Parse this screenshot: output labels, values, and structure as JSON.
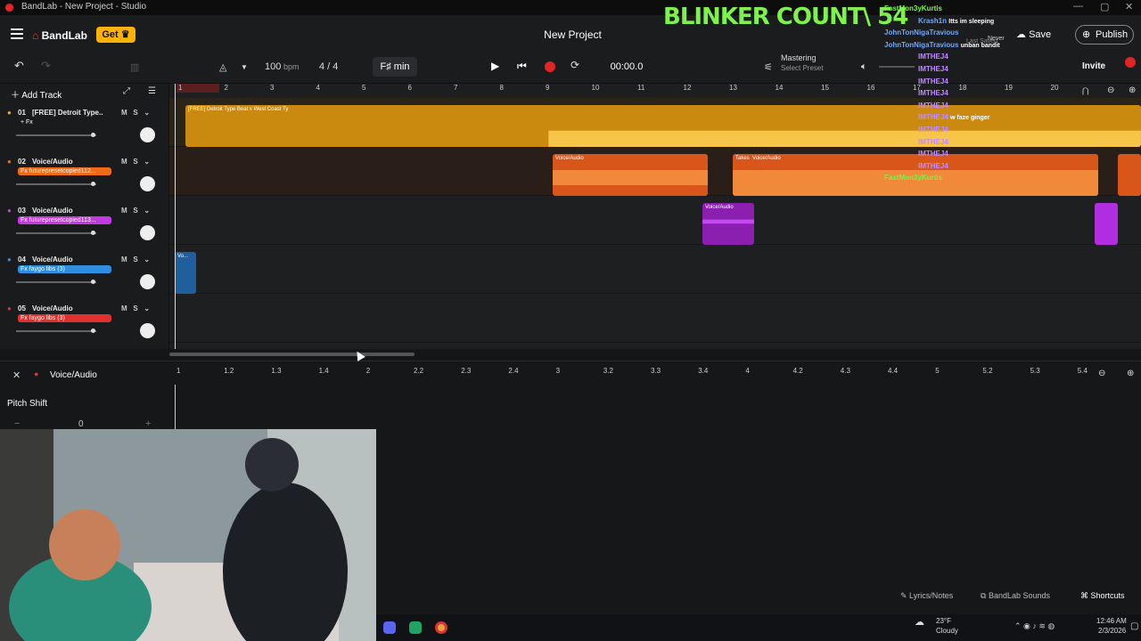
{
  "window": {
    "title": "BandLab - New Project - Studio"
  },
  "header": {
    "logo": "BandLab",
    "get_label": "Get",
    "project_title": "New Project",
    "save_label": "Save",
    "publish_label": "Publish",
    "last_saved": "Last Saved"
  },
  "toolbar": {
    "bpm": "100",
    "bpm_unit": "bpm",
    "time_sig": "4 / 4",
    "key": "F♯ min",
    "time": "00:00.0",
    "mastering": "Mastering",
    "select_preset": "Select Preset",
    "invite": "Invite"
  },
  "tracklist": {
    "add_track": "Add Track",
    "tracks": [
      {
        "num": "01",
        "name": "[FREE] Detroit Type...",
        "fx": "+ Fx",
        "color": "#f5a81c"
      },
      {
        "num": "02",
        "name": "Voice/Audio",
        "fx": "Fx futurepresetcopied112...",
        "color": "#f06a1a"
      },
      {
        "num": "03",
        "name": "Voice/Audio",
        "fx": "Fx futurepresetcopied113...",
        "color": "#c13be0"
      },
      {
        "num": "04",
        "name": "Voice/Audio",
        "fx": "Fx faygo libs (3)",
        "color": "#2f8ee0"
      },
      {
        "num": "05",
        "name": "Voice/Audio",
        "fx": "Fx faygo libs (3)",
        "color": "#e0312f"
      }
    ],
    "mute": "M",
    "solo": "S"
  },
  "ruler": [
    "1",
    "2",
    "3",
    "4",
    "5",
    "6",
    "7",
    "8",
    "9",
    "10",
    "11",
    "12",
    "13",
    "14",
    "15",
    "16",
    "17",
    "18",
    "19",
    "20"
  ],
  "clips": {
    "beat": "[FREE] Detroit Type Beat x West Coast Ty",
    "voice": "Voice/Audio",
    "takes": "Takes",
    "short": "Vo..."
  },
  "editor": {
    "track_name": "Voice/Audio",
    "pitch_label": "Pitch Shift",
    "pitch_value": "0",
    "ruler": [
      "1",
      "1.2",
      "1.3",
      "1.4",
      "2",
      "2.2",
      "2.3",
      "2.4",
      "3",
      "3.2",
      "3.3",
      "3.4",
      "4",
      "4.2",
      "4.3",
      "4.4",
      "5",
      "5.2",
      "5.3",
      "5.4"
    ]
  },
  "bottom": {
    "lyrics": "Lyrics/Notes",
    "sounds": "BandLab Sounds",
    "shortcuts": "Shortcuts"
  },
  "overlay": {
    "blinker": "BLINKER COUNT\\ 54",
    "chat": [
      {
        "user": "FastMon3yKurtis",
        "msg": "",
        "color": "#7cf24a"
      },
      {
        "user": "Krash1n",
        "msg": "Itts im sleeping",
        "color": "#6fa8ff"
      },
      {
        "user": "JohnTonNigaTravious",
        "msg": "",
        "color": "#6fa8ff"
      },
      {
        "user": "JohnTonNigaTravious",
        "msg": "unban bandit",
        "color": "#6fa8ff"
      },
      {
        "user": "IMTHEJ4",
        "msg": "",
        "color": "#c08cff"
      },
      {
        "user": "IMTHEJ4",
        "msg": "",
        "color": "#c08cff"
      },
      {
        "user": "IMTHEJ4",
        "msg": "",
        "color": "#c08cff"
      },
      {
        "user": "IMTHEJ4",
        "msg": "",
        "color": "#c08cff"
      },
      {
        "user": "IMTHEJ4",
        "msg": "",
        "color": "#c08cff"
      },
      {
        "user": "IMTHEJ4",
        "msg": "w faze ginger",
        "color": "#c08cff"
      },
      {
        "user": "IMTHEJ4",
        "msg": "",
        "color": "#c08cff"
      },
      {
        "user": "IMTHEJ4",
        "msg": "",
        "color": "#c08cff"
      },
      {
        "user": "IMTHEJ4",
        "msg": "",
        "color": "#c08cff"
      },
      {
        "user": "IMTHEJ4",
        "msg": "",
        "color": "#c08cff"
      },
      {
        "user": "FastMon3yKurtis",
        "msg": "",
        "color": "#7cf24a"
      }
    ],
    "never": "Never"
  },
  "taskbar": {
    "weather_temp": "23°F",
    "weather_desc": "Cloudy",
    "time": "12:46 AM",
    "date": "2/3/2026"
  }
}
